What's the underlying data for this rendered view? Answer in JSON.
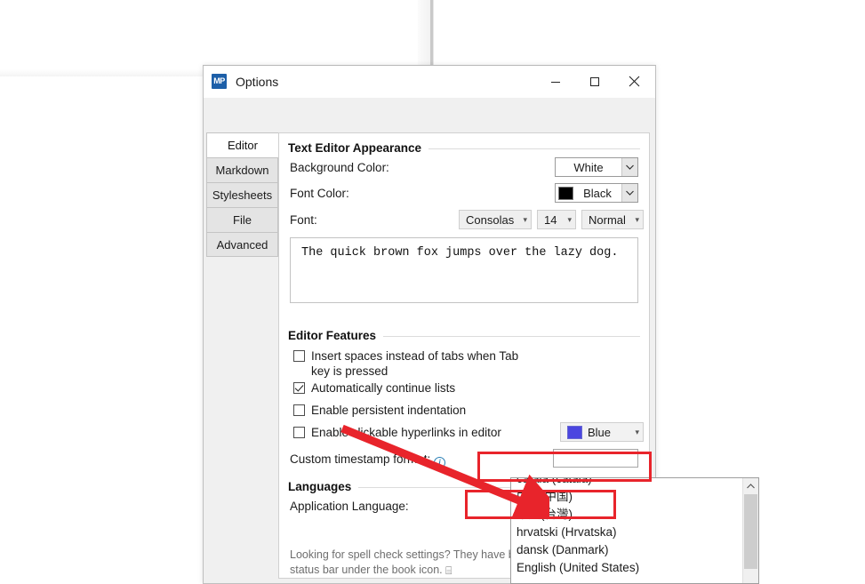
{
  "window": {
    "title": "Options",
    "app_icon_label": "MP",
    "controls": {
      "minimize": "minimize-button",
      "maximize": "maximize-button",
      "close": "close-button"
    }
  },
  "tabs": [
    {
      "label": "Editor",
      "active": true
    },
    {
      "label": "Markdown",
      "active": false
    },
    {
      "label": "Stylesheets",
      "active": false
    },
    {
      "label": "File",
      "active": false
    },
    {
      "label": "Advanced",
      "active": false
    }
  ],
  "appearance": {
    "group_title": "Text Editor Appearance",
    "background_color": {
      "label": "Background Color:",
      "value": "White",
      "swatch": "#ffffff",
      "show_swatch": false
    },
    "font_color": {
      "label": "Font Color:",
      "value": "Black",
      "swatch": "#000000",
      "show_swatch": true
    },
    "font": {
      "label": "Font:",
      "family": "Consolas",
      "size": "14",
      "style": "Normal"
    },
    "preview_text": "The quick brown fox jumps over the lazy dog."
  },
  "features": {
    "group_title": "Editor Features",
    "checkboxes": [
      {
        "label": "Insert spaces instead of tabs when Tab key is pressed",
        "checked": false
      },
      {
        "label": "Automatically continue lists",
        "checked": true
      },
      {
        "label": "Enable persistent indentation",
        "checked": false
      },
      {
        "label": "Enable clickable hyperlinks in editor",
        "checked": false
      }
    ],
    "hyperlink_color": {
      "value": "Blue",
      "swatch": "#4b46e0"
    },
    "timestamp": {
      "label": "Custom timestamp format:",
      "info_glyph": "i",
      "value": "",
      "placeholder": ""
    }
  },
  "languages": {
    "group_title": "Languages",
    "application_language": {
      "label": "Application Language:",
      "value": "English (United States)"
    },
    "hint_line_1": "Looking for spell check settings? They have been m",
    "hint_line_2": "status bar under the book icon.",
    "book_glyph": "⌸"
  },
  "dropdown": {
    "items": [
      {
        "label": "català (català)",
        "highlight": false
      },
      {
        "label": "中文(中国)",
        "highlight": true
      },
      {
        "label": "中文(台灣)",
        "highlight": false
      },
      {
        "label": "hrvatski (Hrvatska)",
        "highlight": false
      },
      {
        "label": "dansk (Danmark)",
        "highlight": false
      },
      {
        "label": "English (United States)",
        "highlight": false
      }
    ],
    "scroll_up_glyph": "▲"
  },
  "annotations": {
    "accent_color": "#e8242b",
    "box_combo": "highlight-application-language-combo",
    "box_item": "highlight-chinese-simplified-option",
    "arrow": "pointer-arrow-to-chinese-option"
  }
}
